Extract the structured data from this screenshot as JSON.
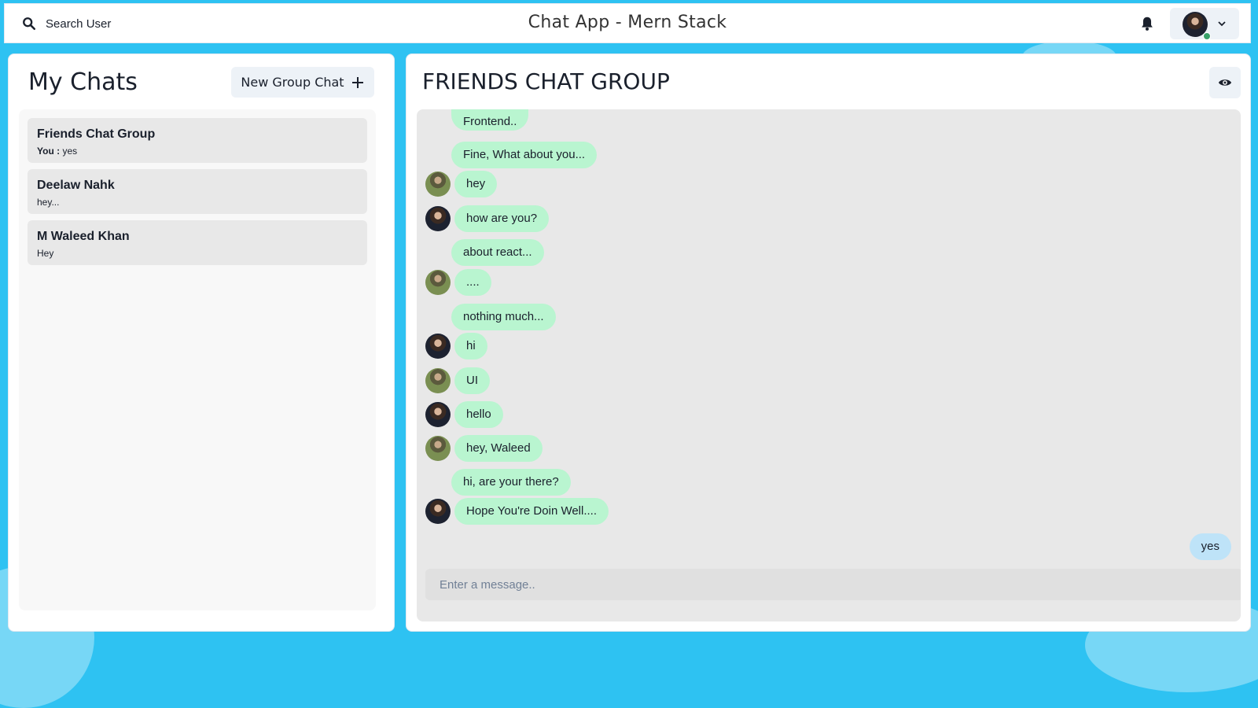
{
  "header": {
    "search_label": "Search User",
    "app_title": "Chat App - Mern Stack",
    "icons": {
      "search": "search-icon",
      "bell": "bell-icon",
      "chevron": "chevron-down-icon"
    }
  },
  "sidebar": {
    "title": "My Chats",
    "new_group_label": "New Group Chat",
    "new_group_icon": "plus-icon",
    "chats": [
      {
        "name": "Friends Chat Group",
        "preview_sender": "You :",
        "preview": "yes"
      },
      {
        "name": "Deelaw Nahk",
        "preview_sender": "",
        "preview": "hey..."
      },
      {
        "name": "M Waleed Khan",
        "preview_sender": "",
        "preview": "Hey"
      }
    ]
  },
  "chat": {
    "title": "FRIENDS CHAT GROUP",
    "view_icon": "eye-icon",
    "input_placeholder": "Enter a message..",
    "messages": [
      {
        "text": "Frontend..",
        "avatar": "",
        "mine": false
      },
      {
        "text": "Fine, What about you...",
        "avatar": "",
        "mine": false
      },
      {
        "text": "hey",
        "avatar": "green",
        "mine": false
      },
      {
        "text": "how are you?",
        "avatar": "dark",
        "mine": false
      },
      {
        "text": "about react...",
        "avatar": "",
        "mine": false
      },
      {
        "text": "....",
        "avatar": "green",
        "mine": false
      },
      {
        "text": "nothing much...",
        "avatar": "",
        "mine": false
      },
      {
        "text": "hi",
        "avatar": "dark",
        "mine": false
      },
      {
        "text": "UI",
        "avatar": "green",
        "mine": false
      },
      {
        "text": "hello",
        "avatar": "dark",
        "mine": false
      },
      {
        "text": "hey, Waleed",
        "avatar": "green",
        "mine": false
      },
      {
        "text": "hi, are your there?",
        "avatar": "",
        "mine": false
      },
      {
        "text": "Hope You're Doin Well....",
        "avatar": "dark",
        "mine": false
      },
      {
        "text": "yes",
        "avatar": "",
        "mine": true
      }
    ]
  },
  "colors": {
    "background": "#2ec2f2",
    "bubble_other": "#b9f5d0",
    "bubble_mine": "#bee3f8",
    "online": "#38a169"
  }
}
